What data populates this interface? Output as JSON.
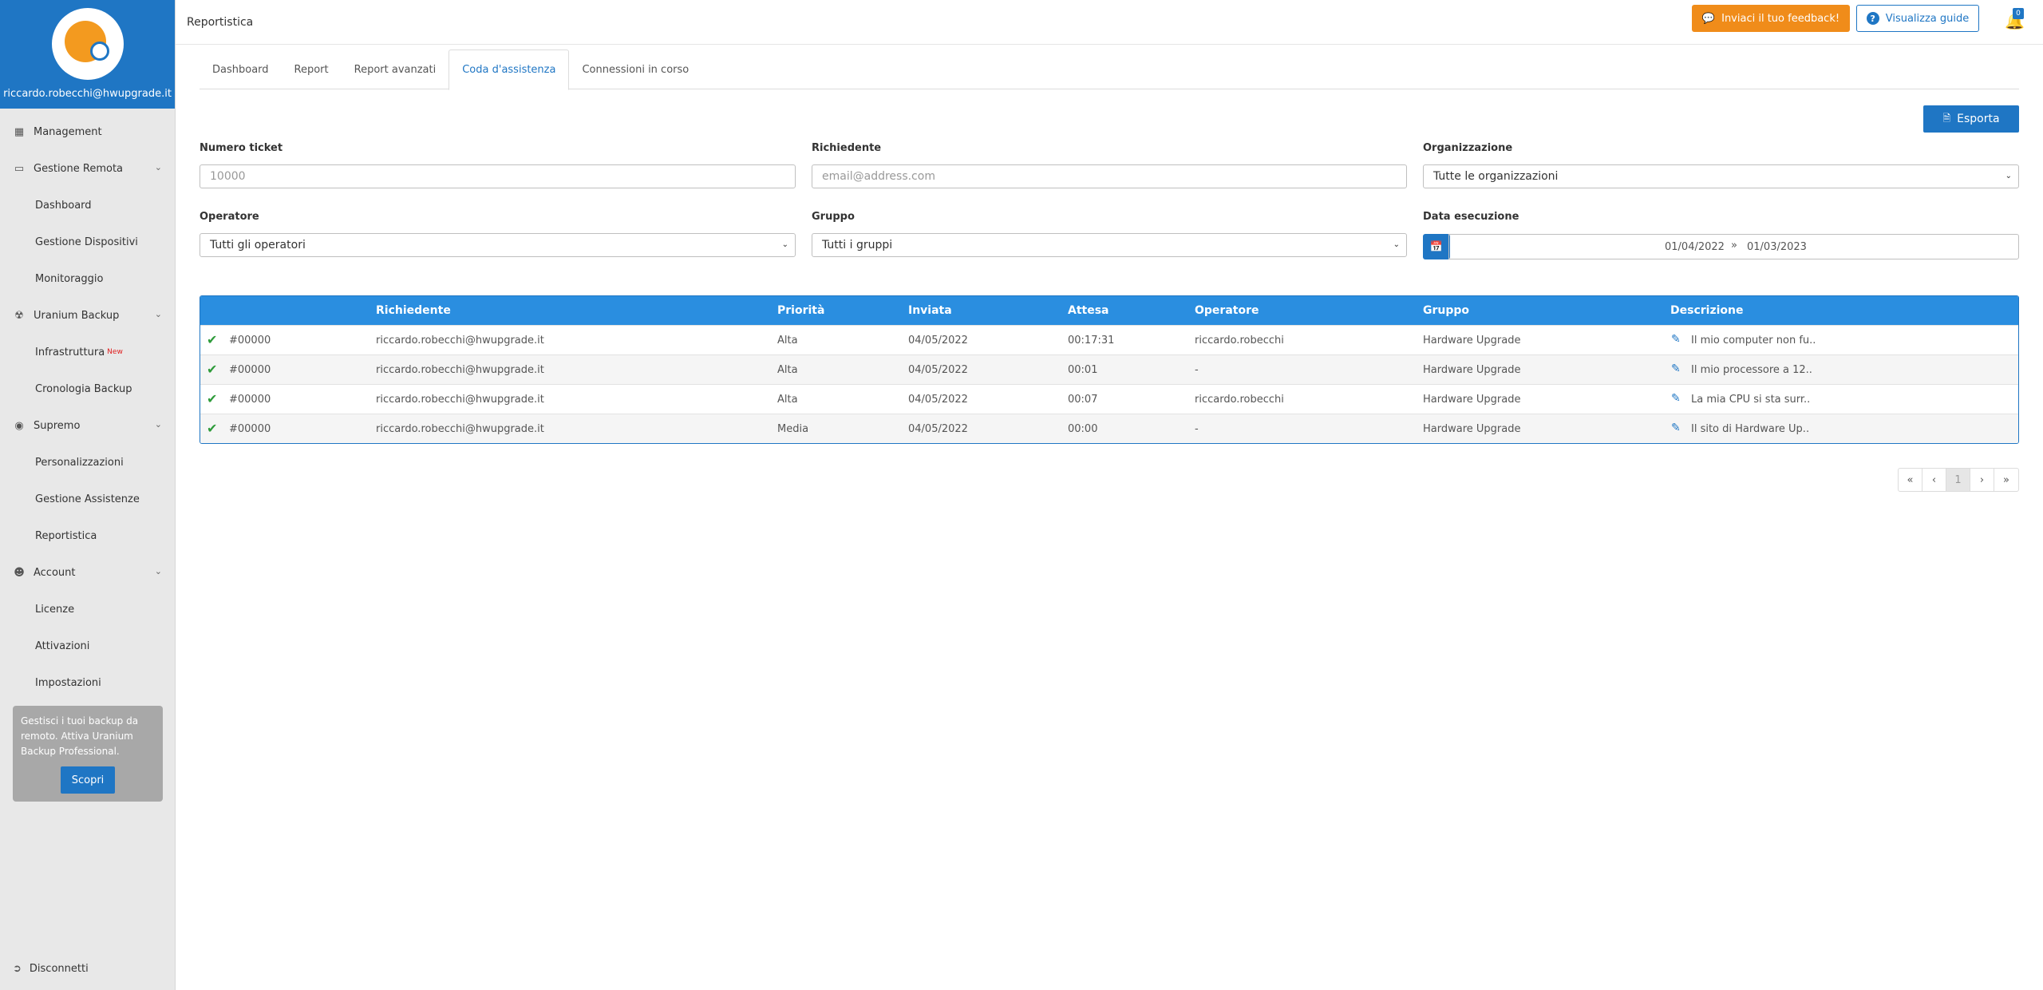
{
  "user": {
    "email": "riccardo.robecchi@hwupgrade.it"
  },
  "sidebar": {
    "sections": [
      {
        "label": "Management",
        "icon": "sitemap-icon"
      },
      {
        "label": "Gestione Remota",
        "icon": "monitor-icon",
        "items": [
          "Dashboard",
          "Gestione Dispositivi",
          "Monitoraggio"
        ]
      },
      {
        "label": "Uranium Backup",
        "icon": "uranium-icon",
        "items": [
          "Infrastruttura",
          "Cronologia Backup"
        ],
        "new_badge": "New"
      },
      {
        "label": "Supremo",
        "icon": "supremo-icon",
        "items": [
          "Personalizzazioni",
          "Gestione Assistenze",
          "Reportistica"
        ]
      },
      {
        "label": "Account",
        "icon": "user-icon",
        "items": [
          "Licenze",
          "Attivazioni",
          "Impostazioni"
        ]
      }
    ],
    "promo": {
      "text": "Gestisci i tuoi backup da remoto. Attiva Uranium Backup Professional.",
      "button": "Scopri"
    },
    "logout": "Disconnetti"
  },
  "header": {
    "title": "Reportistica",
    "feedback_button": "Inviaci il tuo feedback!",
    "guide_button": "Visualizza guide",
    "notifications_count": "0"
  },
  "tabs": [
    {
      "label": "Dashboard",
      "active": false
    },
    {
      "label": "Report",
      "active": false
    },
    {
      "label": "Report avanzati",
      "active": false
    },
    {
      "label": "Coda d'assistenza",
      "active": true
    },
    {
      "label": "Connessioni in corso",
      "active": false
    }
  ],
  "export_button": "Esporta",
  "filters": {
    "ticket": {
      "label": "Numero ticket",
      "placeholder": "10000"
    },
    "requester": {
      "label": "Richiedente",
      "placeholder": "email@address.com"
    },
    "organization": {
      "label": "Organizzazione",
      "value": "Tutte le organizzazioni"
    },
    "operator": {
      "label": "Operatore",
      "value": "Tutti gli operatori"
    },
    "group": {
      "label": "Gruppo",
      "value": "Tutti i gruppi"
    },
    "date": {
      "label": "Data esecuzione",
      "from": "01/04/2022",
      "to": "01/03/2023"
    }
  },
  "table": {
    "columns": [
      "Richiedente",
      "Priorità",
      "Inviata",
      "Attesa",
      "Operatore",
      "Gruppo",
      "Descrizione"
    ],
    "rows": [
      {
        "id": "#00000",
        "requester": "riccardo.robecchi@hwupgrade.it",
        "priority": "Alta",
        "sent": "04/05/2022",
        "wait": "00:17:31",
        "operator": "riccardo.robecchi",
        "group": "Hardware Upgrade",
        "description": "Il mio computer non fu.."
      },
      {
        "id": "#00000",
        "requester": "riccardo.robecchi@hwupgrade.it",
        "priority": "Alta",
        "sent": "04/05/2022",
        "wait": "00:01",
        "operator": "-",
        "group": "Hardware Upgrade",
        "description": "Il mio processore a 12.."
      },
      {
        "id": "#00000",
        "requester": "riccardo.robecchi@hwupgrade.it",
        "priority": "Alta",
        "sent": "04/05/2022",
        "wait": "00:07",
        "operator": "riccardo.robecchi",
        "group": "Hardware Upgrade",
        "description": "La mia CPU si sta surr.."
      },
      {
        "id": "#00000",
        "requester": "riccardo.robecchi@hwupgrade.it",
        "priority": "Media",
        "sent": "04/05/2022",
        "wait": "00:00",
        "operator": "-",
        "group": "Hardware Upgrade",
        "description": "Il sito di Hardware Up.."
      }
    ]
  },
  "pagination": {
    "first": "«",
    "prev": "‹",
    "current": "1",
    "next": "›",
    "last": "»"
  },
  "colors": {
    "primary": "#1f76c4",
    "table_header": "#2a8ee0",
    "accent": "#f08c1a",
    "success": "#2e9b3a"
  }
}
